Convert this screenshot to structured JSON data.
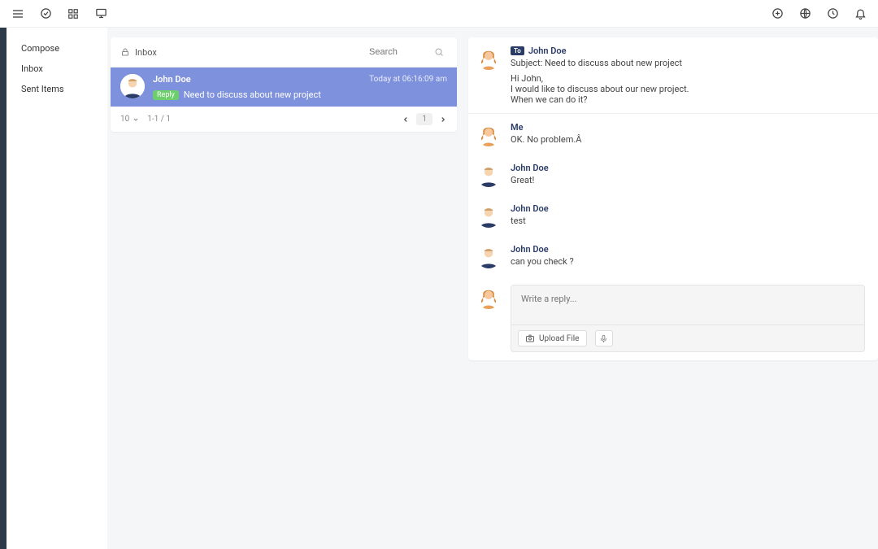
{
  "nav": {
    "items": [
      {
        "label": "Compose"
      },
      {
        "label": "Inbox"
      },
      {
        "label": "Sent Items"
      }
    ]
  },
  "inbox": {
    "title": "Inbox",
    "search_placeholder": "Search",
    "row": {
      "name": "John Doe",
      "time": "Today at 06:16:09 am",
      "reply_badge": "Reply",
      "subject": "Need to discuss about new project"
    },
    "pager": {
      "perpage": "10",
      "range": "1-1 / 1",
      "current": "1"
    }
  },
  "thread": {
    "posts": [
      {
        "to_badge": "To",
        "name": "John Doe",
        "subject": "Subject: Need to discuss about new project",
        "body": "Hi John,\nI would like to discuss about our new project.\nWhen we can do it?",
        "avatar": "orange"
      },
      {
        "name": "Me",
        "body": "OK. No problem.Â ",
        "avatar": "orange"
      },
      {
        "name": "John Doe",
        "body": "Great!",
        "avatar": "blue"
      },
      {
        "name": "John Doe",
        "body": "test",
        "avatar": "blue"
      },
      {
        "name": "John Doe",
        "body": "can you check ?",
        "avatar": "blue"
      }
    ],
    "composer": {
      "placeholder": "Write a reply...",
      "upload_label": "Upload File"
    }
  }
}
